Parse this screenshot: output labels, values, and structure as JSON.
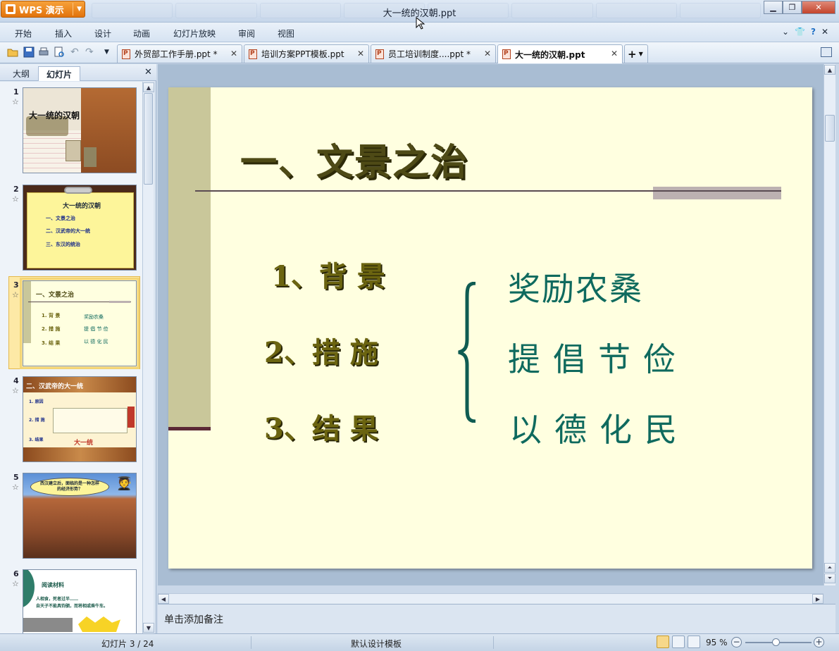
{
  "app": {
    "name": "WPS 演示",
    "window_title": "大一统的汉朝.ppt"
  },
  "menu": {
    "items": [
      "开始",
      "插入",
      "设计",
      "动画",
      "幻灯片放映",
      "审阅",
      "视图"
    ]
  },
  "doc_tabs": [
    {
      "label": "外贸部工作手册.ppt *",
      "active": false
    },
    {
      "label": "培训方案PPT模板.ppt",
      "active": false
    },
    {
      "label": "员工培训制度....ppt *",
      "active": false
    },
    {
      "label": "大一统的汉朝.ppt",
      "active": true
    }
  ],
  "panel": {
    "tabs": [
      "大纲",
      "幻灯片"
    ],
    "active_tab": "幻灯片"
  },
  "thumbnails": [
    {
      "number": "1",
      "title": "大一统的汉朝"
    },
    {
      "number": "2",
      "title": "大一统的汉朝",
      "lines": [
        "一、文景之治",
        "二、汉武帝的大一统",
        "三、东汉的统治"
      ]
    },
    {
      "number": "3",
      "title": "一、文景之治",
      "left": [
        "1. 背  景",
        "2. 措  施",
        "3. 结  果"
      ],
      "right": [
        "奖励农桑",
        "提 倡 节 俭",
        "以 德 化 民"
      ]
    },
    {
      "number": "4",
      "title": "二、汉武帝的大一统",
      "labels": [
        "1. 原因",
        "2. 措 施",
        "3. 结果"
      ],
      "highlight": "大一统"
    },
    {
      "number": "5",
      "bubble": "西汉建立后，面临的是一种怎样的经济形势？"
    },
    {
      "number": "6",
      "title": "阅读材料",
      "lines": [
        "人相食，死者过半……",
        "自天子不能具钧驷，而将相或乘牛车。"
      ]
    }
  ],
  "slide": {
    "title": "一、文景之治",
    "points": [
      "1、背  景",
      "2、措  施",
      "3、结  果"
    ],
    "measures": [
      "奖励农桑",
      "提倡节俭",
      "以德化民"
    ]
  },
  "notes": {
    "placeholder": "单击添加备注"
  },
  "status": {
    "slide_counter": "幻灯片 3 / 24",
    "template": "默认设计模板",
    "zoom": "95 %"
  },
  "colors": {
    "accent_orange": "#e2730c",
    "slide_bg": "#ffffe0",
    "title_olive": "#4e4a16",
    "measure_teal": "#0f6a5e"
  }
}
